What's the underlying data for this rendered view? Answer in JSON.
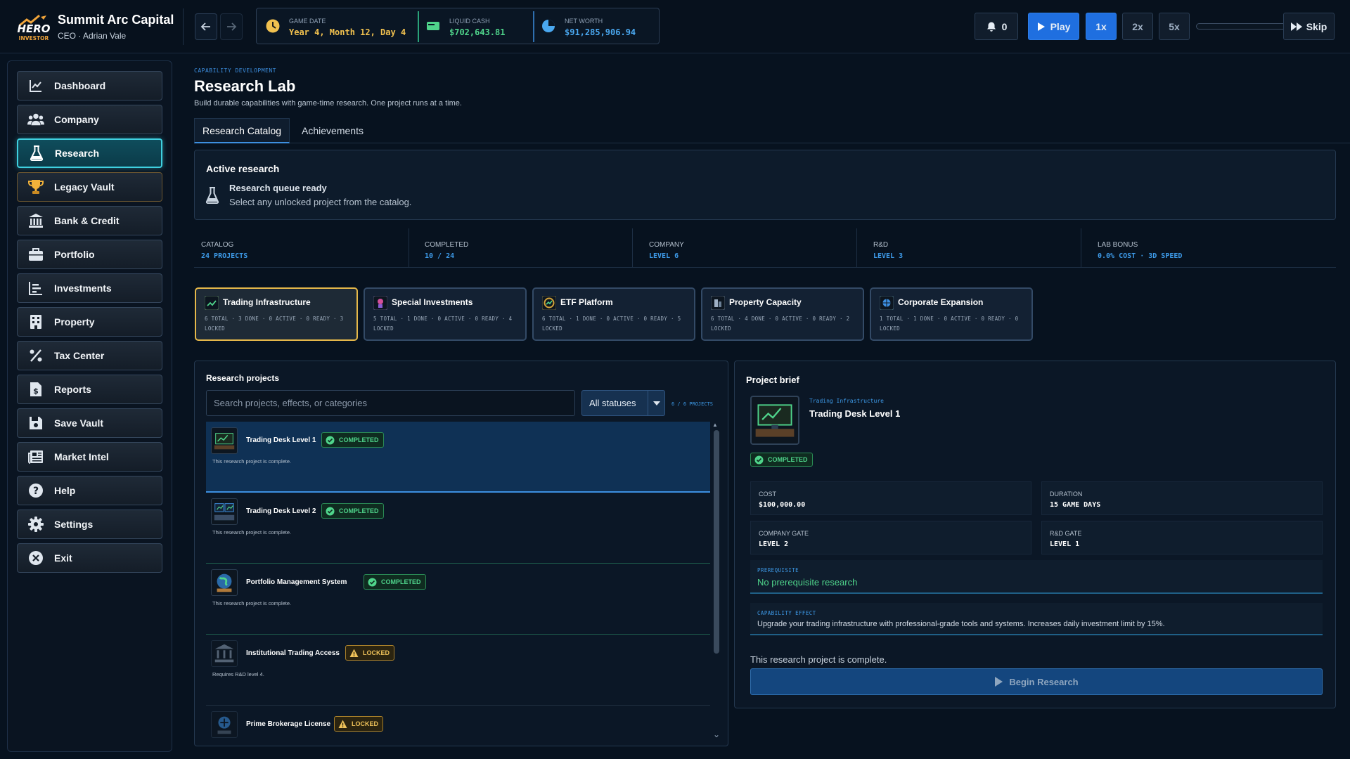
{
  "brand": {
    "logo_text": "HERO INVESTOR",
    "company": "Summit Arc Capital",
    "subtitle": "CEO · Adrian Vale"
  },
  "topbar": {
    "back_icon": "arrow-left-icon",
    "forward_icon": "arrow-right-icon",
    "stats": [
      {
        "label": "GAME DATE",
        "value": "Year 4, Month 12, Day 4",
        "icon": "clock-icon",
        "color": "#f1c14f"
      },
      {
        "label": "LIQUID CASH",
        "value": "$702,643.81",
        "icon": "cash-icon",
        "color": "#4fd48b"
      },
      {
        "label": "NET WORTH",
        "value": "$91,285,906.94",
        "icon": "pie-chart-icon",
        "color": "#4aa8f0"
      }
    ],
    "notifications": "0",
    "play_label": "Play",
    "speeds": [
      "1x",
      "2x",
      "5x"
    ],
    "active_speed": "1x",
    "day_progress": 0,
    "skip_label": "Skip"
  },
  "sidebar": {
    "items": [
      {
        "label": "Dashboard",
        "icon": "line-chart-icon"
      },
      {
        "label": "Company",
        "icon": "users-icon"
      },
      {
        "label": "Research",
        "icon": "flask-icon"
      },
      {
        "label": "Legacy Vault",
        "icon": "trophy-icon"
      },
      {
        "label": "Bank & Credit",
        "icon": "bank-icon"
      },
      {
        "label": "Portfolio",
        "icon": "briefcase-icon"
      },
      {
        "label": "Investments",
        "icon": "bar-chart-icon"
      },
      {
        "label": "Property",
        "icon": "building-icon"
      },
      {
        "label": "Tax Center",
        "icon": "percent-icon"
      },
      {
        "label": "Reports",
        "icon": "report-icon"
      },
      {
        "label": "Save Vault",
        "icon": "save-icon"
      },
      {
        "label": "Market Intel",
        "icon": "newspaper-icon"
      },
      {
        "label": "Help",
        "icon": "help-icon"
      },
      {
        "label": "Settings",
        "icon": "gear-icon"
      },
      {
        "label": "Exit",
        "icon": "close-icon"
      }
    ],
    "active": "Research"
  },
  "page": {
    "eyebrow": "CAPABILITY DEVELOPMENT",
    "title": "Research Lab",
    "subtitle": "Build durable capabilities with game-time research. One project runs at a time.",
    "tabs": [
      "Research Catalog",
      "Achievements"
    ],
    "active_tab": "Research Catalog"
  },
  "active_research": {
    "title": "Active research",
    "status_title": "Research queue ready",
    "status_sub": "Select any unlocked project from the catalog."
  },
  "summary": [
    {
      "label": "CATALOG",
      "value": "24 PROJECTS"
    },
    {
      "label": "COMPLETED",
      "value": "10 / 24"
    },
    {
      "label": "COMPANY",
      "value": "LEVEL 6"
    },
    {
      "label": "R&D",
      "value": "LEVEL 3"
    },
    {
      "label": "LAB BONUS",
      "value": "0.0% COST · 3D SPEED"
    }
  ],
  "categories": [
    {
      "name": "Trading Infrastructure",
      "meta": "6 TOTAL · 3 DONE · 0 ACTIVE · 0 READY · 3 LOCKED",
      "active": true
    },
    {
      "name": "Special Investments",
      "meta": "5 TOTAL · 1 DONE · 0 ACTIVE · 0 READY · 4 LOCKED",
      "active": false
    },
    {
      "name": "ETF Platform",
      "meta": "6 TOTAL · 1 DONE · 0 ACTIVE · 0 READY · 5 LOCKED",
      "active": false
    },
    {
      "name": "Property Capacity",
      "meta": "6 TOTAL · 4 DONE · 0 ACTIVE · 0 READY · 2 LOCKED",
      "active": false
    },
    {
      "name": "Corporate Expansion",
      "meta": "1 TOTAL · 1 DONE · 0 ACTIVE · 0 READY · 0 LOCKED",
      "active": false
    }
  ],
  "projects": {
    "title": "Research projects",
    "search_placeholder": "Search projects, effects, or categories",
    "status_filter": "All statuses",
    "count": "6 / 6 PROJECTS",
    "items": [
      {
        "name": "Trading Desk Level 1",
        "status": "COMPLETED",
        "desc": "This research project is complete.",
        "selected": true
      },
      {
        "name": "Trading Desk Level 2",
        "status": "COMPLETED",
        "desc": "This research project is complete.",
        "selected": false
      },
      {
        "name": "Portfolio Management System",
        "status": "COMPLETED",
        "desc": "This research project is complete.",
        "selected": false
      },
      {
        "name": "Institutional Trading Access",
        "status": "LOCKED",
        "desc": "Requires R&D level 4.",
        "selected": false
      },
      {
        "name": "Prime Brokerage License",
        "status": "LOCKED",
        "desc": "",
        "selected": false
      }
    ]
  },
  "brief": {
    "title": "Project brief",
    "category": "Trading Infrastructure",
    "name": "Trading Desk Level 1",
    "status": "COMPLETED",
    "cost_label": "COST",
    "cost": "$100,000.00",
    "duration_label": "DURATION",
    "duration": "15 GAME DAYS",
    "company_gate_label": "COMPANY GATE",
    "company_gate": "LEVEL 2",
    "rd_gate_label": "R&D GATE",
    "rd_gate": "LEVEL 1",
    "prereq_label": "PREREQUISITE",
    "prereq": "No prerequisite research",
    "effect_label": "CAPABILITY EFFECT",
    "effect": "Upgrade your trading infrastructure with professional-grade tools and systems. Increases daily investment limit by 15%.",
    "status_text": "This research project is complete.",
    "action_label": "Begin Research"
  }
}
